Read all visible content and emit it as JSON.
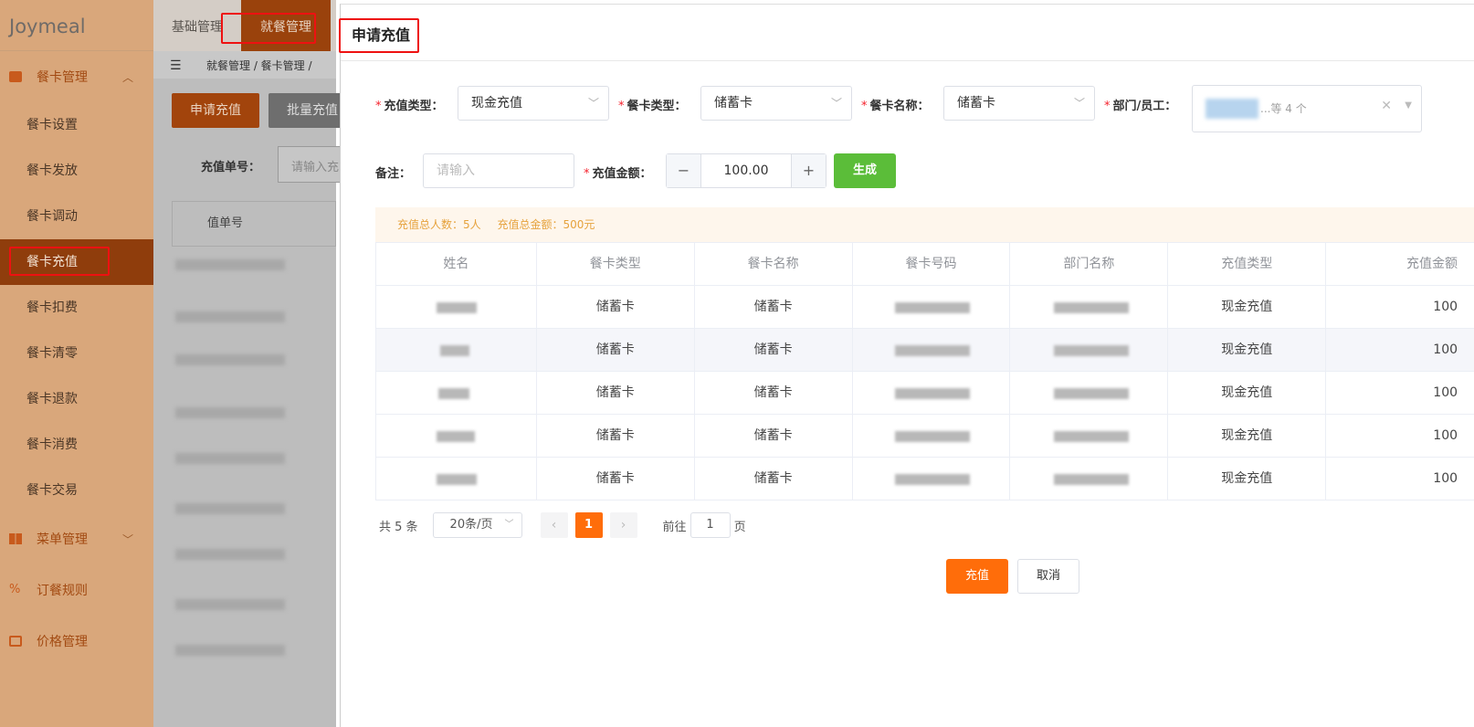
{
  "app": {
    "logo": "Joymeal"
  },
  "topbar": {
    "tabs": [
      {
        "label": "基础管理"
      },
      {
        "label": "就餐管理"
      }
    ]
  },
  "breadcrumb": {
    "text": "就餐管理  /  餐卡管理  /"
  },
  "sidebar": {
    "groups": [
      {
        "label": "餐卡管理",
        "icon": "card-icon",
        "expanded": true
      },
      {
        "label": "菜单管理",
        "icon": "grid-icon",
        "expanded": false
      },
      {
        "label": "订餐规则",
        "icon": "percent-icon"
      },
      {
        "label": "价格管理",
        "icon": "price-icon"
      }
    ],
    "items": [
      {
        "label": "餐卡设置"
      },
      {
        "label": "餐卡发放"
      },
      {
        "label": "餐卡调动"
      },
      {
        "label": "餐卡充值",
        "active": true
      },
      {
        "label": "餐卡扣费"
      },
      {
        "label": "餐卡清零"
      },
      {
        "label": "餐卡退款"
      },
      {
        "label": "餐卡消费"
      },
      {
        "label": "餐卡交易"
      }
    ]
  },
  "background_page": {
    "apply_button": "申请充值",
    "batch_button": "批量充值",
    "search_label": "充值单号：",
    "search_placeholder": "请输入充",
    "table_header": "值单号"
  },
  "dialog": {
    "title": "申请充值",
    "form": {
      "recharge_type_label": "充值类型：",
      "recharge_type_value": "现金充值",
      "card_type_label": "餐卡类型：",
      "card_type_value": "储蓄卡",
      "card_name_label": "餐卡名称：",
      "card_name_value": "储蓄卡",
      "dept_label": "部门/员工：",
      "dept_more": "...等 4 个",
      "remark_label": "备注：",
      "remark_placeholder": "请输入",
      "amount_label": "充值金额：",
      "amount_value": "100.00",
      "generate_button": "生成"
    },
    "summary": {
      "people": "充值总人数：5人",
      "total": "充值总金额：500元"
    },
    "table": {
      "columns": [
        "姓名",
        "餐卡类型",
        "餐卡名称",
        "餐卡号码",
        "部门名称",
        "充值类型",
        "充值金额"
      ],
      "rows": [
        {
          "card_type": "储蓄卡",
          "card_name": "储蓄卡",
          "recharge_type": "现金充值",
          "amount": "100"
        },
        {
          "card_type": "储蓄卡",
          "card_name": "储蓄卡",
          "recharge_type": "现金充值",
          "amount": "100"
        },
        {
          "card_type": "储蓄卡",
          "card_name": "储蓄卡",
          "recharge_type": "现金充值",
          "amount": "100"
        },
        {
          "card_type": "储蓄卡",
          "card_name": "储蓄卡",
          "recharge_type": "现金充值",
          "amount": "100"
        },
        {
          "card_type": "储蓄卡",
          "card_name": "储蓄卡",
          "recharge_type": "现金充值",
          "amount": "100"
        }
      ]
    },
    "pagination": {
      "total": "共 5 条",
      "page_size": "20条/页",
      "current_page": "1",
      "goto_prefix": "前往",
      "goto_value": "1",
      "goto_suffix": "页"
    },
    "buttons": {
      "confirm": "充值",
      "cancel": "取消"
    }
  },
  "colors": {
    "accent": "#ff6d0a",
    "success": "#5bbd39",
    "required": "#f5222d",
    "highlight_box": "#ee1111"
  }
}
